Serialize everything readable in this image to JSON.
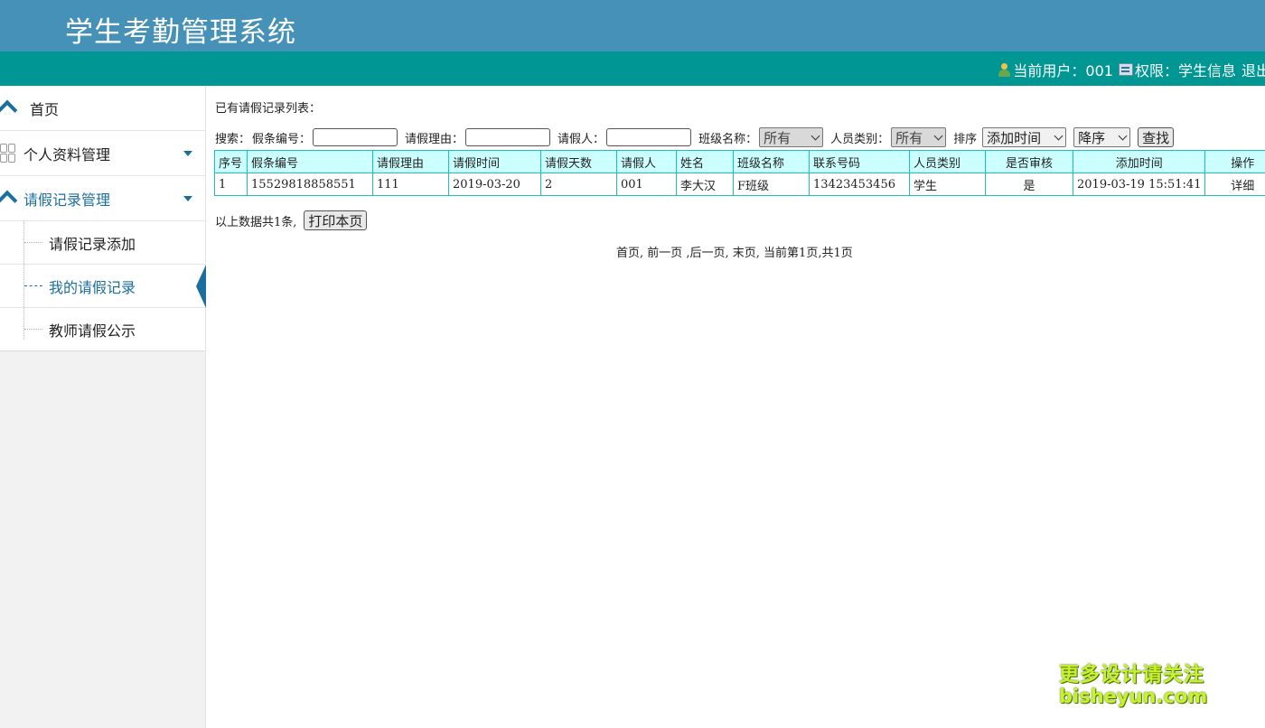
{
  "header": {
    "title": "学生考勤管理系统"
  },
  "user_bar": {
    "current_user_label": "当前用户：001",
    "permission_label": "权限：学生信息",
    "logout_label": "退出"
  },
  "sidebar": {
    "items": [
      {
        "label": "首页",
        "icon": "home-icon"
      },
      {
        "label": "个人资料管理",
        "icon": "grid-icon"
      },
      {
        "label": "请假记录管理",
        "icon": "home-icon"
      }
    ],
    "subitems": [
      {
        "label": "请假记录添加"
      },
      {
        "label": "我的请假记录",
        "active": true
      },
      {
        "label": "教师请假公示"
      }
    ]
  },
  "main": {
    "list_title": "已有请假记录列表：",
    "search": {
      "label": "搜索：",
      "leave_no_label": "假条编号：",
      "reason_label": "请假理由：",
      "applicant_label": "请假人：",
      "class_label": "班级名称：",
      "class_value": "所有",
      "person_type_label": "人员类别：",
      "person_type_value": "所有",
      "sort_label": "排序",
      "sort_field_value": "添加时间",
      "sort_order_value": "降序",
      "search_button": "查找"
    },
    "table": {
      "columns": [
        "序号",
        "假条编号",
        "请假理由",
        "请假时间",
        "请假天数",
        "请假人",
        "姓名",
        "班级名称",
        "联系号码",
        "人员类别",
        "是否审核",
        "添加时间",
        "操作"
      ],
      "rows": [
        [
          "1",
          "15529818858551",
          "111",
          "2019-03-20",
          "2",
          "001",
          "李大汉",
          "F班级",
          "13423453456",
          "学生",
          "是",
          "2019-03-19 15:51:41",
          "详细"
        ]
      ]
    },
    "summary_text": "以上数据共1条,",
    "print_button": "打印本页",
    "pager_text": "首页, 前一页 ,后一页, 末页, 当前第1页,共1页"
  },
  "watermark": {
    "line1": "更多设计请关注",
    "line2": "bisheyun.com"
  },
  "colors": {
    "header_bg": "#4591b8",
    "userbar_bg": "#009694",
    "accent": "#1a6f9e",
    "table_border": "#1fbfbb",
    "table_header_bg": "#ccffff"
  }
}
